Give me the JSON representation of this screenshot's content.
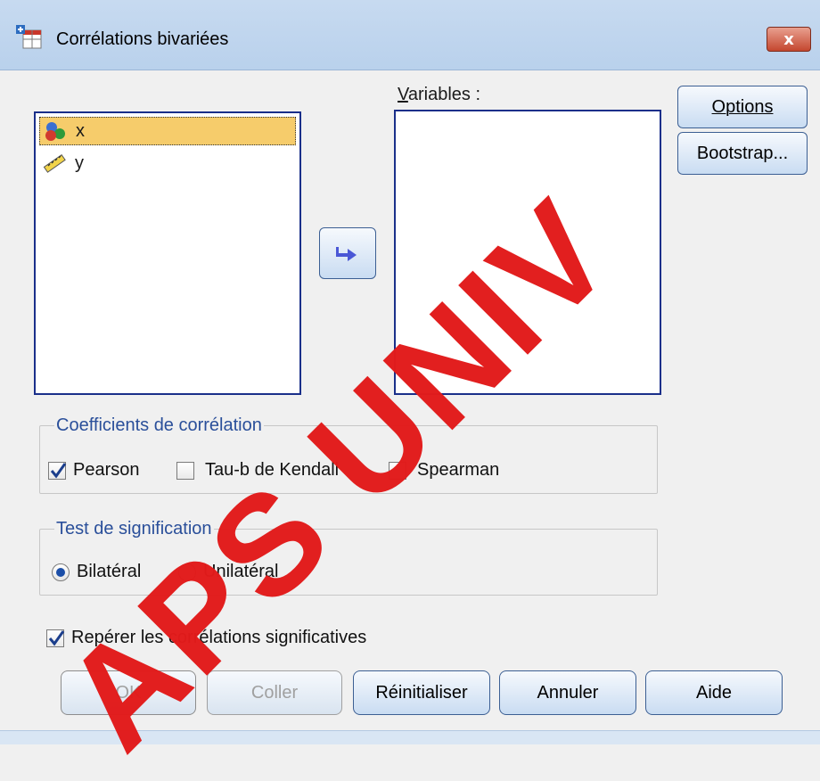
{
  "window": {
    "title": "Corrélations bivariées",
    "close_glyph": "x"
  },
  "source_list": {
    "items": [
      {
        "label": "x",
        "icon": "nominal-variable-icon",
        "selected": true
      },
      {
        "label": "y",
        "icon": "scale-variable-icon",
        "selected": false
      }
    ]
  },
  "target_list": {
    "label": "Variables :"
  },
  "side_buttons": {
    "options": "Options",
    "bootstrap": "Bootstrap..."
  },
  "move_button": {
    "icon": "arrow-right-icon"
  },
  "correlation_group": {
    "legend": "Coefficients de corrélation",
    "options": [
      {
        "label": "Pearson",
        "checked": true
      },
      {
        "label": "Tau-b de Kendall",
        "checked": false
      },
      {
        "label": "Spearman",
        "checked": false
      }
    ]
  },
  "significance_group": {
    "legend": "Test de signification",
    "options": [
      {
        "label": "Bilatéral",
        "selected": true
      },
      {
        "label": "Unilatéral",
        "selected": false
      }
    ]
  },
  "flag_significant": {
    "label": "Repérer les corrélations significatives",
    "checked": true
  },
  "footer_buttons": {
    "ok": "OK",
    "paste": "Coller",
    "reset": "Réinitialiser",
    "cancel": "Annuler",
    "help": "Aide"
  },
  "watermark": {
    "text": "APS UNIV"
  },
  "colors": {
    "accent": "#1a2f8a",
    "selection": "#f6cc6b",
    "group_legend": "#2a4f9a",
    "watermark": "#e21b1b"
  }
}
